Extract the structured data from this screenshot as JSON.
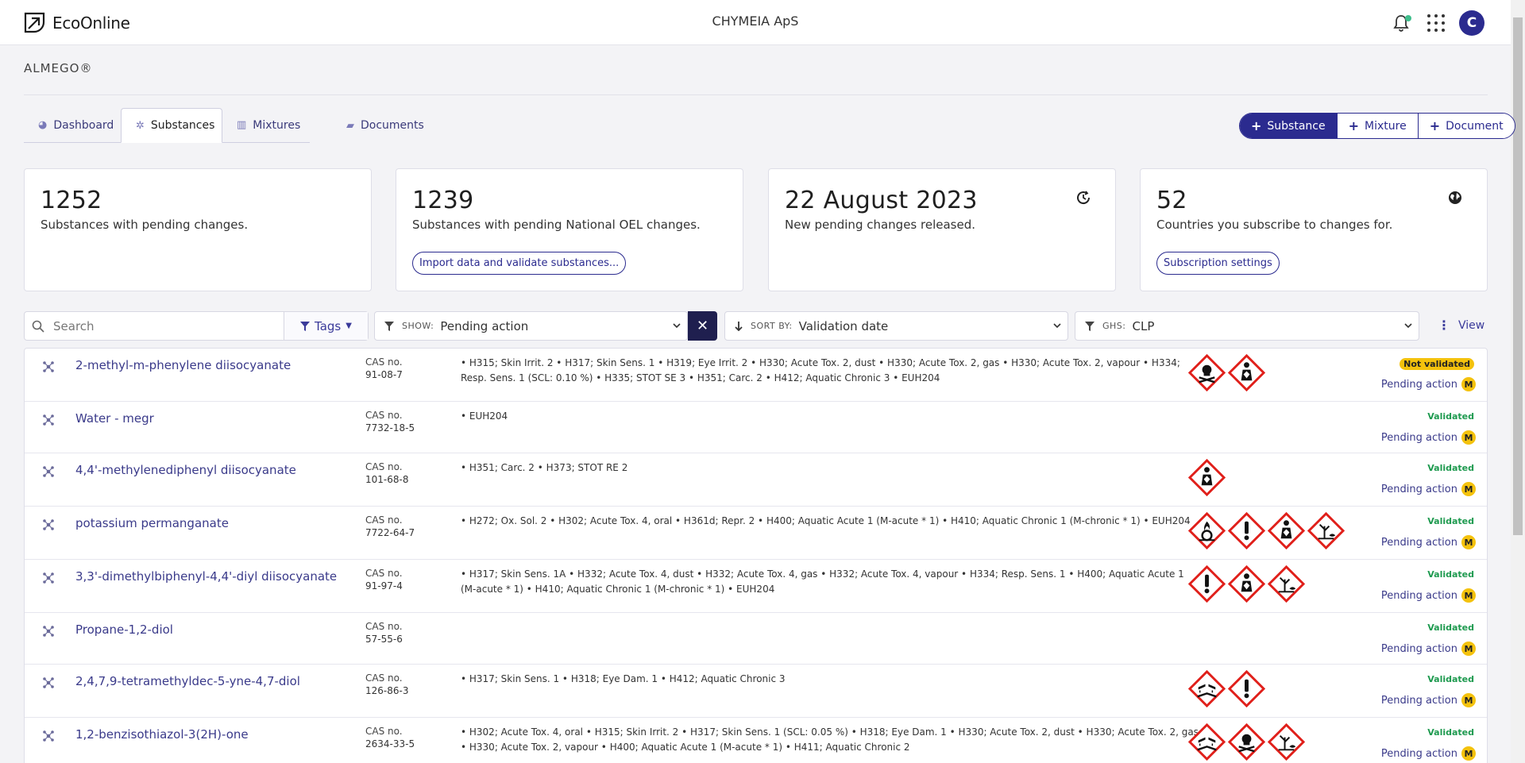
{
  "header": {
    "brand": "EcoOnline",
    "org": "CHYMEIA ApS",
    "avatar_initial": "C"
  },
  "product": "ALMEGO®",
  "tabs": [
    {
      "label": "Dashboard",
      "icon": "dashboard-icon",
      "active": false
    },
    {
      "label": "Substances",
      "icon": "molecule-icon",
      "active": true
    },
    {
      "label": "Mixtures",
      "icon": "flask-icon",
      "active": false
    },
    {
      "label": "Documents",
      "icon": "folder-icon",
      "active": false
    }
  ],
  "add_buttons": [
    "Substance",
    "Mixture",
    "Document"
  ],
  "cards": [
    {
      "value": "1252",
      "label": "Substances with pending changes.",
      "button": ""
    },
    {
      "value": "1239",
      "label": "Substances with pending National OEL changes.",
      "button": "Import data and validate substances..."
    },
    {
      "value": "22 August 2023",
      "label": "New pending changes released.",
      "button": ""
    },
    {
      "value": "52",
      "label": "Countries you subscribe to changes for.",
      "button": "Subscription settings"
    }
  ],
  "filters": {
    "search_placeholder": "Search",
    "tags_label": "Tags",
    "show_label": "SHOW:",
    "show_value": "Pending action",
    "sort_label": "SORT BY:",
    "sort_value": "Validation date",
    "ghs_label": "GHS:",
    "ghs_value": "CLP",
    "view_label": "View"
  },
  "cas_label": "CAS no.",
  "pending_label": "Pending action",
  "m_badge": "M",
  "rows": [
    {
      "name": "2-methyl-m-phenylene diisocyanate",
      "cas": "91-08-7",
      "hazards": "• H315; Skin Irrit. 2 • H317; Skin Sens. 1 • H319; Eye Irrit. 2 • H330; Acute Tox. 2, dust • H330; Acute Tox. 2, gas • H330; Acute Tox. 2, vapour • H334; Resp. Sens. 1 (SCL: 0.10 %) • H335; STOT SE 3 • H351; Carc. 2 • H412; Aquatic Chronic 3 • EUH204",
      "pictograms": [
        "skull",
        "health"
      ],
      "status": "Not validated"
    },
    {
      "name": "Water - megr",
      "cas": "7732-18-5",
      "hazards": "• EUH204",
      "pictograms": [],
      "status": "Validated"
    },
    {
      "name": "4,4'-methylenediphenyl diisocyanate",
      "cas": "101-68-8",
      "hazards": "• H351; Carc. 2 • H373; STOT RE 2",
      "pictograms": [
        "health"
      ],
      "status": "Validated"
    },
    {
      "name": "potassium permanganate",
      "cas": "7722-64-7",
      "hazards": "• H272; Ox. Sol. 2 • H302; Acute Tox. 4, oral • H361d; Repr. 2 • H400; Aquatic Acute 1 (M-acute * 1) • H410; Aquatic Chronic 1 (M-chronic * 1) • EUH204",
      "pictograms": [
        "flame-o",
        "exclaim",
        "health",
        "env"
      ],
      "status": "Validated"
    },
    {
      "name": "3,3'-dimethylbiphenyl-4,4'-diyl diisocyanate",
      "cas": "91-97-4",
      "hazards": "• H317; Skin Sens. 1A • H332; Acute Tox. 4, dust • H332; Acute Tox. 4, gas • H332; Acute Tox. 4, vapour • H334; Resp. Sens. 1 • H400; Aquatic Acute 1 (M-acute * 1) • H410; Aquatic Chronic 1 (M-chronic * 1) • EUH204",
      "pictograms": [
        "exclaim",
        "health",
        "env"
      ],
      "status": "Validated"
    },
    {
      "name": "Propane-1,2-diol",
      "cas": "57-55-6",
      "hazards": "",
      "pictograms": [],
      "status": "Validated"
    },
    {
      "name": "2,4,7,9-tetramethyldec-5-yne-4,7-diol",
      "cas": "126-86-3",
      "hazards": "• H317; Skin Sens. 1 • H318; Eye Dam. 1 • H412; Aquatic Chronic 3",
      "pictograms": [
        "corrosive",
        "exclaim"
      ],
      "status": "Validated"
    },
    {
      "name": "1,2-benzisothiazol-3(2H)-one",
      "cas": "2634-33-5",
      "hazards": "• H302; Acute Tox. 4, oral • H315; Skin Irrit. 2 • H317; Skin Sens. 1 (SCL: 0.05 %) • H318; Eye Dam. 1 • H330; Acute Tox. 2, dust • H330; Acute Tox. 2, gas • H330; Acute Tox. 2, vapour • H400; Aquatic Acute 1 (M-acute * 1) • H411; Aquatic Chronic 2",
      "pictograms": [
        "corrosive",
        "skull",
        "env"
      ],
      "status": "Validated"
    }
  ],
  "colors": {
    "brand": "#2b2b8f",
    "validated": "#1e9a4f",
    "warning": "#f4c20d",
    "ghs_red": "#e0201b"
  }
}
